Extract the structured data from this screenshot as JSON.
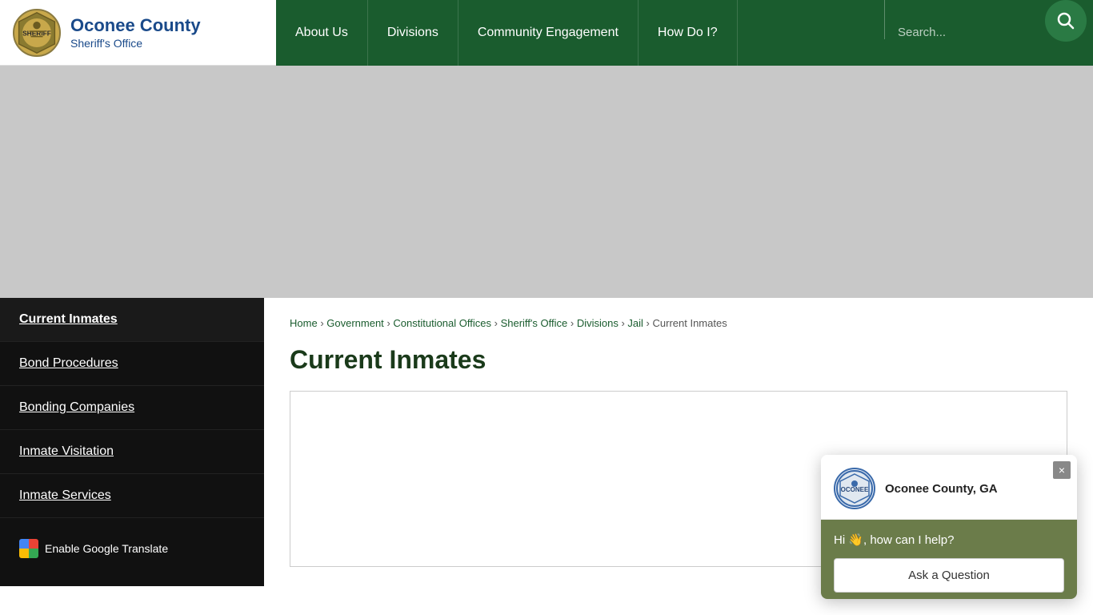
{
  "header": {
    "logo_title": "Oconee County",
    "logo_subtitle": "Sheriff's Office"
  },
  "nav": {
    "items": [
      {
        "label": "About Us",
        "id": "about-us"
      },
      {
        "label": "Divisions",
        "id": "divisions"
      },
      {
        "label": "Community Engagement",
        "id": "community-engagement"
      },
      {
        "label": "How Do I?",
        "id": "how-do-i"
      }
    ],
    "search_placeholder": "Search..."
  },
  "sidebar": {
    "items": [
      {
        "label": "Current Inmates",
        "active": true,
        "id": "current-inmates"
      },
      {
        "label": "Bond Procedures",
        "active": false,
        "id": "bond-procedures"
      },
      {
        "label": "Bonding Companies",
        "active": false,
        "id": "bonding-companies"
      },
      {
        "label": "Inmate Visitation",
        "active": false,
        "id": "inmate-visitation"
      },
      {
        "label": "Inmate Services",
        "active": false,
        "id": "inmate-services"
      }
    ],
    "translate_label": "Enable Google Translate"
  },
  "breadcrumb": {
    "items": [
      {
        "label": "Home",
        "href": "#"
      },
      {
        "label": "Government",
        "href": "#"
      },
      {
        "label": "Constitutional Offices",
        "href": "#"
      },
      {
        "label": "Sheriff's Office",
        "href": "#"
      },
      {
        "label": "Divisions",
        "href": "#"
      },
      {
        "label": "Jail",
        "href": "#"
      },
      {
        "label": "Current Inmates",
        "href": null
      }
    ],
    "separator": "›"
  },
  "page": {
    "title": "Current Inmates"
  },
  "chat": {
    "org_name": "Oconee County, GA",
    "greeting": "Hi 👋, how can I help?",
    "ask_button": "Ask a Question",
    "close_label": "×"
  }
}
